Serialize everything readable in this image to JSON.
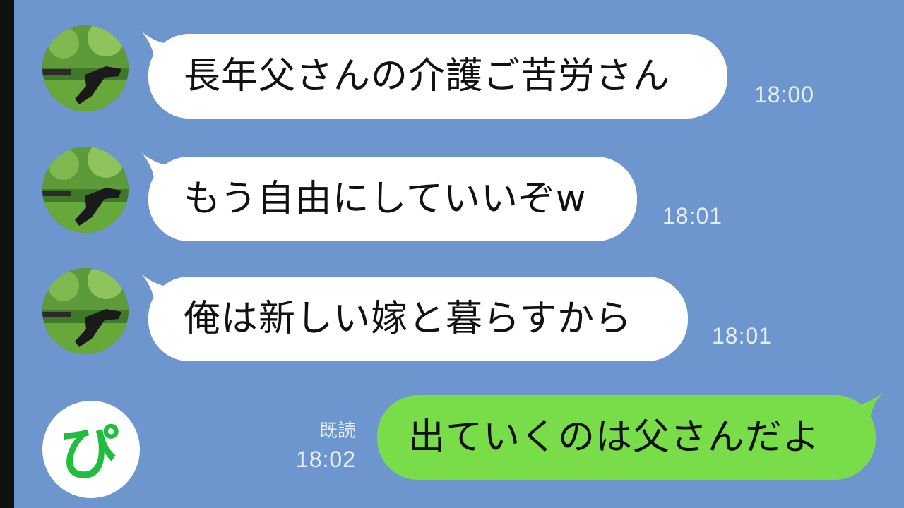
{
  "chat": {
    "messages": [
      {
        "sender": "other",
        "text": "長年父さんの介護ご苦労さん",
        "time": "18:00"
      },
      {
        "sender": "other",
        "text": "もう自由にしていいぞw",
        "time": "18:01"
      },
      {
        "sender": "other",
        "text": "俺は新しい嫁と暮らすから",
        "time": "18:01"
      },
      {
        "sender": "self",
        "text": "出ていくのは父さんだよ",
        "time": "18:02",
        "read_label": "既読"
      }
    ]
  },
  "logo": {
    "icon": "pi-logo-icon",
    "text": "ぴ",
    "color": "#1fbe3c"
  },
  "colors": {
    "background": "#6d96cf",
    "incoming_bubble": "#ffffff",
    "outgoing_bubble": "#79dc49",
    "timestamp": "#e8eef7"
  }
}
